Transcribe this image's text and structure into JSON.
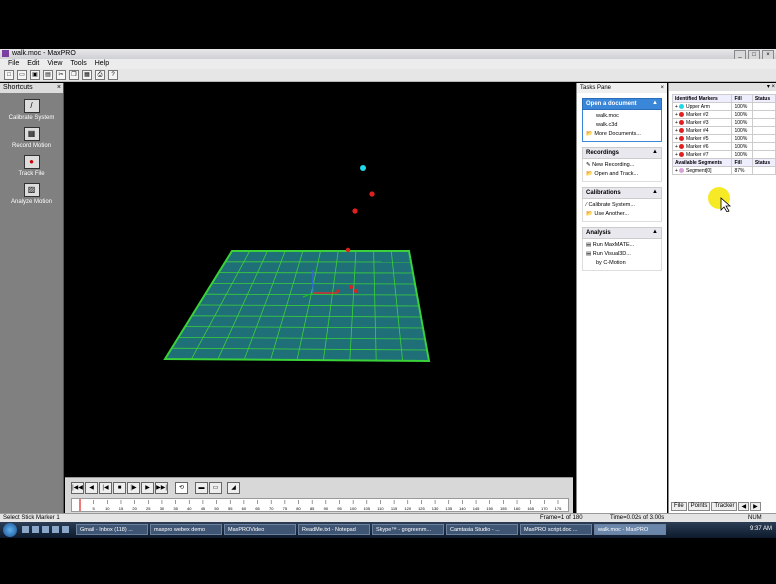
{
  "window": {
    "title": "walk.moc - MaxPRO",
    "controls": [
      "_",
      "□",
      "×"
    ]
  },
  "menu": [
    "File",
    "Edit",
    "View",
    "Tools",
    "Help"
  ],
  "toolbar": {
    "icons": [
      "new-icon",
      "open-icon",
      "save-icon",
      "save-all-icon",
      "cut-icon",
      "copy-icon",
      "paste-icon",
      "print-icon",
      "help-icon"
    ],
    "glyphs": [
      "□",
      "▭",
      "▣",
      "▤",
      "✂",
      "❐",
      "▦",
      "⎙",
      "?"
    ]
  },
  "shortcuts": {
    "title": "Shortcuts",
    "close": "×",
    "items": [
      {
        "label": "Calibrate System",
        "glyph": "/"
      },
      {
        "label": "Record Motion",
        "glyph": "▦"
      },
      {
        "label": "Track File",
        "glyph": "●"
      },
      {
        "label": "Analyze Motion",
        "glyph": "▨"
      }
    ]
  },
  "tasks_pane": {
    "title": "Tasks Pane",
    "close": "×",
    "groups": [
      {
        "title": "Open a document",
        "chev": "▲",
        "items": [
          "walk.moc",
          "walk.c3d",
          "More Documents..."
        ]
      },
      {
        "title": "Recordings",
        "chev": "▲",
        "items": [
          "New Recording...",
          "Open and Track..."
        ]
      },
      {
        "title": "Calibrations",
        "chev": "▲",
        "items": [
          "Calibrate System...",
          "Use Another..."
        ]
      },
      {
        "title": "Analysis",
        "chev": "▲",
        "items": [
          "Run MaxMATE...",
          "Run Visual3D...",
          "by C-Motion"
        ]
      }
    ]
  },
  "markers_panel": {
    "top_controls": "▾ ×",
    "identified_header": [
      "Identified Markers",
      "Fill",
      "Status"
    ],
    "markers": [
      {
        "name": "Upper Arm",
        "fill": "100%",
        "color": "#21d7e8"
      },
      {
        "name": "Marker #2",
        "fill": "100%",
        "color": "#e02020"
      },
      {
        "name": "Marker #3",
        "fill": "100%",
        "color": "#e02020"
      },
      {
        "name": "Marker #4",
        "fill": "100%",
        "color": "#e02020"
      },
      {
        "name": "Marker #5",
        "fill": "100%",
        "color": "#e02020"
      },
      {
        "name": "Marker #6",
        "fill": "100%",
        "color": "#e02020"
      },
      {
        "name": "Marker #7",
        "fill": "100%",
        "color": "#e02020"
      }
    ],
    "segments_header": [
      "Available Segments",
      "Fill",
      "Status"
    ],
    "segments": [
      {
        "name": "Segment[0]",
        "fill": "87%"
      }
    ],
    "tabs": [
      "File",
      "Points",
      "Tracker",
      "◀",
      "▶"
    ]
  },
  "playback": {
    "buttons": [
      "|◀◀",
      "◀",
      "|◀",
      "■",
      "|▶",
      "▶",
      "▶▶|",
      "⟲",
      "▬",
      "▭",
      "◢"
    ],
    "ruler_ticks": [
      "5",
      "10",
      "15",
      "20",
      "25",
      "30",
      "35",
      "40",
      "45",
      "50",
      "55",
      "60",
      "65",
      "70",
      "75",
      "80",
      "85",
      "90",
      "95",
      "100",
      "105",
      "110",
      "115",
      "120",
      "125",
      "130",
      "135",
      "140",
      "145",
      "150",
      "155",
      "160",
      "165",
      "170",
      "175"
    ]
  },
  "statusbar": {
    "message": "Select Stick Marker 1",
    "frame": "Frame=1 of 180",
    "time": "Time=0.02s of 3.00s",
    "num": "NUM"
  },
  "taskbar": {
    "items": [
      "Gmail - Inbox (118) ...",
      "maxpro webex demo",
      "MaxPROVideo",
      "ReadMe.txt - Notepad",
      "Skype™ - gogreenm...",
      "Camtasia Studio - ...",
      "MaxPRO script.doc ...",
      "walk.moc - MaxPRO"
    ],
    "clock": "9:37 AM"
  },
  "scene": {
    "grid_color": "#3ad13a",
    "plane_color": "#1f6f78",
    "marker_color": "#e02020",
    "head_marker_color": "#21d7e8"
  }
}
